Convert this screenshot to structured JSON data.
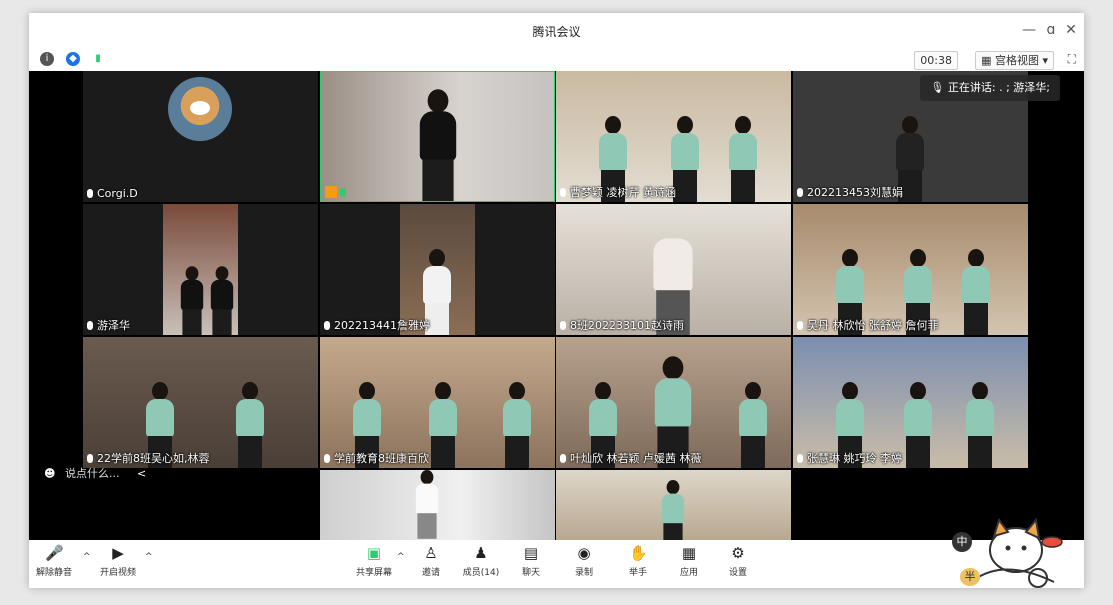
{
  "window": {
    "title": "腾讯会议",
    "minimize": "—",
    "restore": "ɑ",
    "close": "✕"
  },
  "toolbar": {
    "timer": "00:38",
    "view_label": "宫格视图",
    "view_caret": "▾",
    "fullscreen": "⛶"
  },
  "speaking": {
    "label": "正在讲话: . ; 游泽华;"
  },
  "tiles": [
    {
      "name": "Corgi.D"
    },
    {
      "name": ""
    },
    {
      "name": "曹梦颖 凌树芹 黄诗涵"
    },
    {
      "name": "202213453刘慧娟"
    },
    {
      "name": "游泽华"
    },
    {
      "name": "202213441詹雅婷"
    },
    {
      "name": "8班202233101赵诗雨"
    },
    {
      "name": "吴丹 林欣怡 张舒婷 詹何菲"
    },
    {
      "name": "22学前8班吴心如,林蓉"
    },
    {
      "name": "学前教育8班康百欣"
    },
    {
      "name": "叶灿欣 林若颖 卢媛茜 林薇"
    },
    {
      "name": "张慧琳 姚巧玲 李婷"
    },
    {
      "name": ""
    },
    {
      "name": ""
    }
  ],
  "chat": {
    "placeholder": "说点什么...",
    "collapse": "<"
  },
  "bottombar": {
    "unmute": "解除静音",
    "start_video": "开启视频",
    "share": "共享屏幕",
    "invite": "邀请",
    "members": "成员(14)",
    "chat": "聊天",
    "record": "录制",
    "raise_hand": "举手",
    "apps": "应用",
    "settings": "设置",
    "caret": "^"
  },
  "sticker": {
    "text1": "中",
    "text2": "半"
  },
  "colors": {
    "accent": "#1a73e8",
    "active_border": "#2ecc71",
    "shirt": "#8fc9b5"
  }
}
